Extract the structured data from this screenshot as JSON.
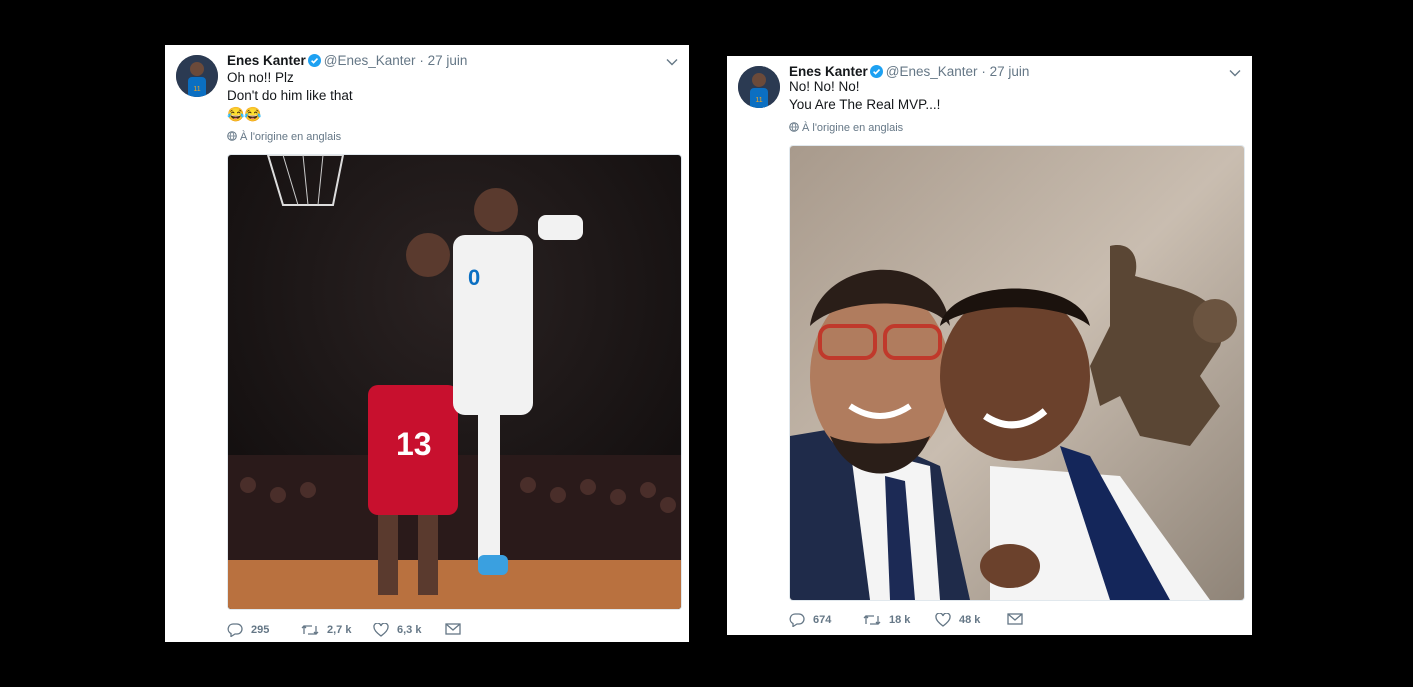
{
  "tweets": [
    {
      "author_name": "Enes Kanter",
      "handle": "@Enes_Kanter",
      "separator": "·",
      "date": "27 juin",
      "lines": [
        "Oh no!! Plz",
        "Don't do him like that"
      ],
      "emoji": "😂😂",
      "translation_note": "À l'origine en anglais",
      "media_icon": "basketball-dunk-photo",
      "stats": {
        "replies": "295",
        "retweets": "2,7 k",
        "likes": "6,3 k"
      }
    },
    {
      "author_name": "Enes Kanter",
      "handle": "@Enes_Kanter",
      "separator": "·",
      "date": "27 juin",
      "lines": [
        "No! No! No!",
        "You Are The Real MVP...!"
      ],
      "translation_note": "À l'origine en anglais",
      "media_icon": "selfie-with-mvp-trophy-photo",
      "stats": {
        "replies": "674",
        "retweets": "18 k",
        "likes": "48 k"
      }
    }
  ],
  "colors": {
    "background": "#000000",
    "card": "#ffffff",
    "text": "#14171a",
    "muted": "#657786",
    "verified": "#1da1f2"
  }
}
